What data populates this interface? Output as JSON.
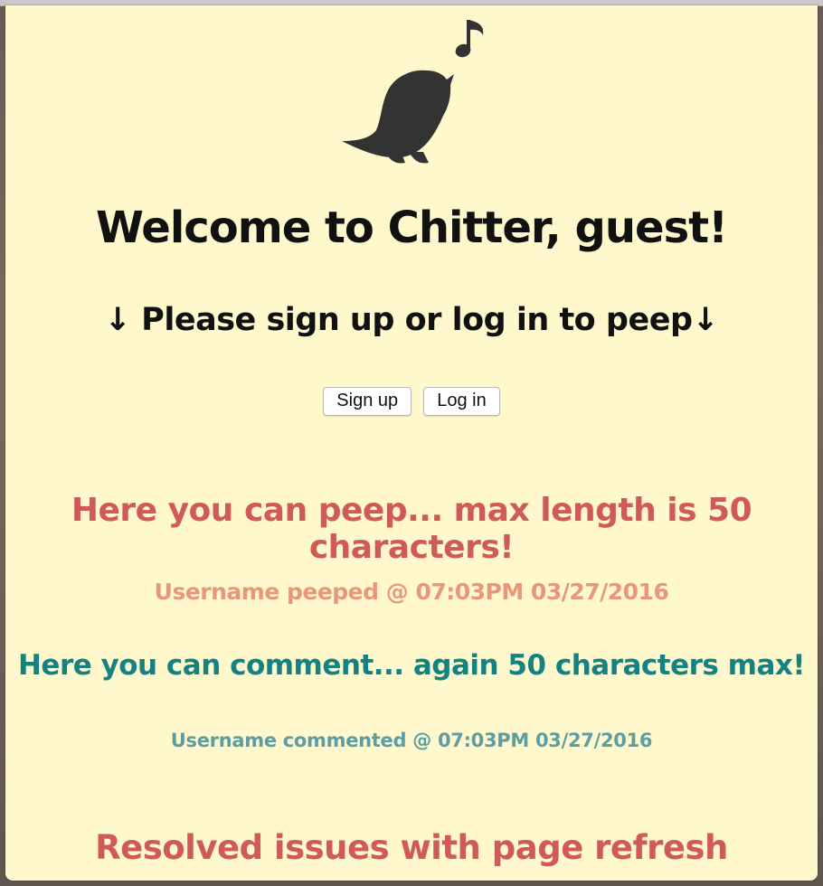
{
  "header": {
    "logo_icon": "singing-bird-icon",
    "welcome": "Welcome to Chitter, guest!",
    "prompt": "↓ Please sign up or log in to peep↓"
  },
  "auth": {
    "signup_label": "Sign up",
    "login_label": "Log in"
  },
  "feed": {
    "peep_text": "Here you can peep... max length is 50 characters!",
    "peep_meta": "Username peeped @ 07:03PM 03/27/2016",
    "comment_text": "Here you can comment... again 50 characters max!",
    "comment_meta": "Username commented @ 07:03PM 03/27/2016",
    "resolved_text": "Resolved issues with page refresh"
  },
  "colors": {
    "background": "#fff8cc",
    "peep": "#d05a5a",
    "peep_meta": "#e8987a",
    "comment": "#158282",
    "comment_meta": "#5e9ea3",
    "logo": "#333333"
  }
}
